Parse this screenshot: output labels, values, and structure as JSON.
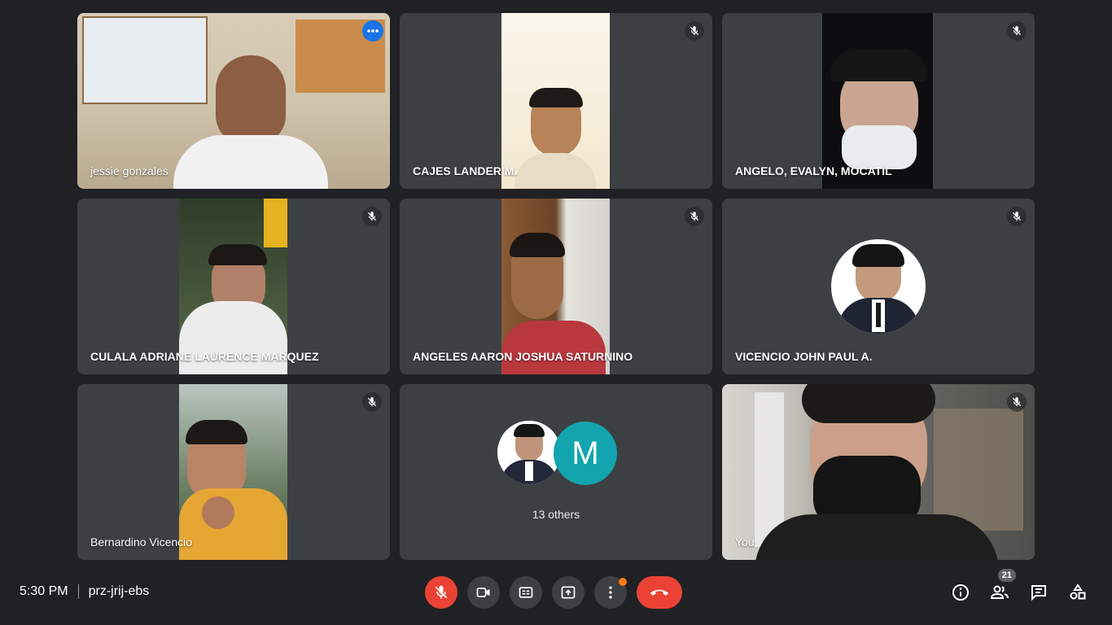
{
  "participants": [
    {
      "name": "jessie gonzales",
      "active": true
    },
    {
      "name": "CAJES LANDER M.",
      "muted": true
    },
    {
      "name": "ANGELO, EVALYN, MOCATIL",
      "muted": true
    },
    {
      "name": "CULALA ADRIANE LAURENCE MARQUEZ",
      "muted": true
    },
    {
      "name": "ANGELES AARON JOSHUA SATURNINO",
      "muted": true
    },
    {
      "name": "VICENCIO JOHN PAUL A.",
      "muted": true
    },
    {
      "name": "Bernardino Vicencio",
      "muted": true
    },
    {
      "name": "You",
      "muted": true
    }
  ],
  "others": {
    "label": "13 others",
    "initial": "M",
    "initial_color": "#12a4af"
  },
  "meeting": {
    "time": "5:30 PM",
    "code": "prz-jrij-ebs"
  },
  "controls": {
    "mic": "mic-off-icon",
    "camera": "videocam-icon",
    "captions": "closed-caption-icon",
    "present": "present-screen-icon",
    "more": "more-vert-icon",
    "end_call": "call-end-icon"
  },
  "people_count": "21",
  "colors": {
    "background": "#202124",
    "tile": "#3c4043",
    "accent": "#1a73e8",
    "end_call": "#ea4335",
    "notification": "#fa7b17"
  }
}
